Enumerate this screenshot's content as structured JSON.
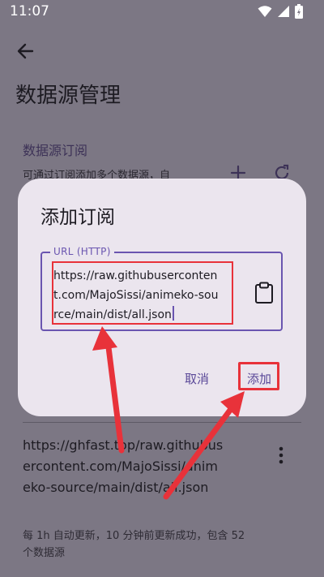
{
  "status": {
    "time": "11:07"
  },
  "header": {
    "title": "数据源管理"
  },
  "section": {
    "title": "数据源订阅",
    "description": "可通过订阅添加多个数据源，自"
  },
  "dialog": {
    "title": "添加订阅",
    "field_label": "URL (HTTP)",
    "field_value": "https://raw.githubusercontent.com/MajoSissi/animeko-source/main/dist/all.json",
    "cancel_label": "取消",
    "add_label": "添加"
  },
  "subscription": {
    "url": "https://ghfast.top/raw.githubusercontent.com/MajoSissi/animeko-source/main/dist/all.json",
    "status": "每 1h 自动更新，10 分钟前更新成功，包含 52 个数据源"
  },
  "colors": {
    "accent": "#6a55b0",
    "highlight": "#e8323a",
    "dialog_bg": "#ebe5ee"
  }
}
